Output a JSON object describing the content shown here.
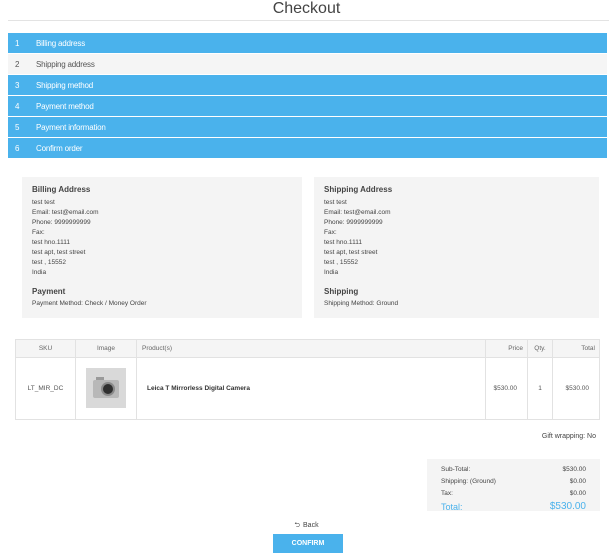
{
  "page": {
    "title": "Checkout"
  },
  "steps": [
    {
      "num": "1",
      "label": "Billing address",
      "state": "active"
    },
    {
      "num": "2",
      "label": "Shipping address",
      "state": "plain"
    },
    {
      "num": "3",
      "label": "Shipping method",
      "state": "active"
    },
    {
      "num": "4",
      "label": "Payment method",
      "state": "active"
    },
    {
      "num": "5",
      "label": "Payment information",
      "state": "active"
    },
    {
      "num": "6",
      "label": "Confirm order",
      "state": "active"
    }
  ],
  "billing": {
    "heading": "Billing Address",
    "name": "test test",
    "email": "Email: test@email.com",
    "phone": "Phone: 9999999999",
    "fax": "Fax:",
    "address1": "test hno.1111",
    "address2": "test apt, test street",
    "city": "test , 15552",
    "country": "India",
    "payment_heading": "Payment",
    "payment_method": "Payment Method: Check / Money Order"
  },
  "shipping": {
    "heading": "Shipping Address",
    "name": "test test",
    "email": "Email: test@email.com",
    "phone": "Phone: 9999999999",
    "fax": "Fax:",
    "address1": "test hno.1111",
    "address2": "test apt, test street",
    "city": "test , 15552",
    "country": "India",
    "method_heading": "Shipping",
    "method": "Shipping Method: Ground"
  },
  "table": {
    "headers": {
      "sku": "SKU",
      "image": "Image",
      "product": "Product(s)",
      "price": "Price",
      "qty": "Qty.",
      "total": "Total"
    },
    "rows": [
      {
        "sku": "LT_MIR_DC",
        "product": "Leica T Mirrorless Digital Camera",
        "price": "$530.00",
        "qty": "1",
        "total": "$530.00",
        "icon": "camera-product-image"
      }
    ]
  },
  "gift_wrapping": "Gift wrapping: No",
  "totals": {
    "subtotal_label": "Sub-Total:",
    "subtotal": "$530.00",
    "shipping_label": "Shipping: (Ground)",
    "shipping": "$0.00",
    "tax_label": "Tax:",
    "tax": "$0.00",
    "total_label": "Total:",
    "total": "$530.00"
  },
  "actions": {
    "back_label": "Back",
    "confirm_label": "CONFIRM"
  },
  "colors": {
    "accent": "#4ab2ec",
    "panel": "#f4f4f4"
  }
}
